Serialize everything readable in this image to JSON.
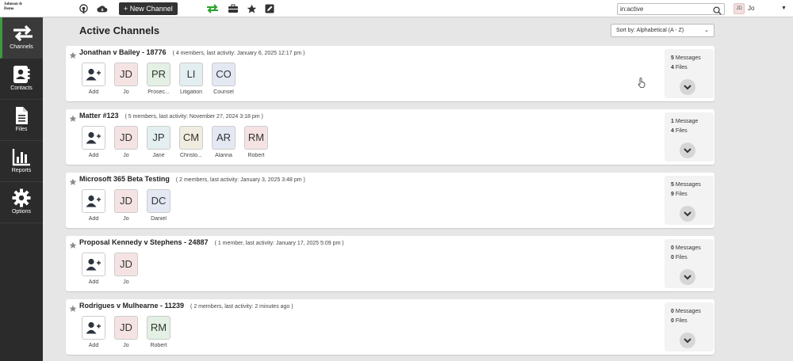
{
  "app": {
    "logo_line1": "Johnson &",
    "logo_line2": "Demo"
  },
  "toolbar": {
    "new_channel_label": "+ New Channel"
  },
  "search": {
    "value": "in:active"
  },
  "user": {
    "initials": "JD",
    "name": "Jo"
  },
  "sidebar": {
    "items": [
      {
        "label": "Channels",
        "icon": "arrows-icon"
      },
      {
        "label": "Contacts",
        "icon": "contacts-icon"
      },
      {
        "label": "Files",
        "icon": "file-icon"
      },
      {
        "label": "Reports",
        "icon": "bar-chart-icon"
      },
      {
        "label": "Options",
        "icon": "gear-icon"
      }
    ]
  },
  "main": {
    "title": "Active Channels",
    "sort_label": "Sort by: Alphabetical (A - Z)",
    "add_label": "Add",
    "channels": [
      {
        "title": "Jonathan v Bailey - 18776",
        "meta": "( 4 members, last activity: January 6, 2025 12:17 pm )",
        "members": [
          {
            "initials": "JD",
            "name": "Jo",
            "color": "#f5e3e3"
          },
          {
            "initials": "PR",
            "name": "Prosec...",
            "color": "#e3f0e3"
          },
          {
            "initials": "LI",
            "name": "Litigation",
            "color": "#e3eef0"
          },
          {
            "initials": "CO",
            "name": "Counsel",
            "color": "#e3e8f3"
          }
        ],
        "messages": "5",
        "messages_label": "Messages",
        "files": "4",
        "files_label": "Files"
      },
      {
        "title": "Matter #123",
        "meta": "( 5 members, last activity: November 27, 2024 3:18 pm )",
        "members": [
          {
            "initials": "JD",
            "name": "Jo",
            "color": "#f5e3e3"
          },
          {
            "initials": "JP",
            "name": "Jane",
            "color": "#e3eff0"
          },
          {
            "initials": "CM",
            "name": "Christo...",
            "color": "#f0ece0"
          },
          {
            "initials": "AR",
            "name": "Alanna",
            "color": "#e3e8f3"
          },
          {
            "initials": "RM",
            "name": "Robert",
            "color": "#f5e3e3"
          }
        ],
        "messages": "1",
        "messages_label": "Message",
        "files": "4",
        "files_label": "Files"
      },
      {
        "title": "Microsoft 365 Beta Testing",
        "meta": "( 2 members, last activity: January 3, 2025 3:48 pm )",
        "members": [
          {
            "initials": "JD",
            "name": "Jo",
            "color": "#f5e3e3"
          },
          {
            "initials": "DC",
            "name": "Daniel",
            "color": "#e3e8f3"
          }
        ],
        "messages": "5",
        "messages_label": "Messages",
        "files": "9",
        "files_label": "Files"
      },
      {
        "title": "Proposal Kennedy v Stephens - 24887",
        "meta": "( 1 member, last activity: January 17, 2025 5:09 pm )",
        "members": [
          {
            "initials": "JD",
            "name": "Jo",
            "color": "#f5e3e3"
          }
        ],
        "messages": "0",
        "messages_label": "Messages",
        "files": "0",
        "files_label": "Files"
      },
      {
        "title": "Rodrigues v Mulhearne - 11239",
        "meta": "( 2 members, last activity: 2 minutes ago )",
        "members": [
          {
            "initials": "JD",
            "name": "Jo",
            "color": "#f5e3e3"
          },
          {
            "initials": "RM",
            "name": "Robert",
            "color": "#e3f0e3"
          }
        ],
        "messages": "0",
        "messages_label": "Messages",
        "files": "0",
        "files_label": "Files"
      }
    ]
  },
  "colors": {
    "sidebar_bg": "#2b2b2b",
    "accent_green": "#3d9a3d",
    "button_dark": "#333333"
  }
}
